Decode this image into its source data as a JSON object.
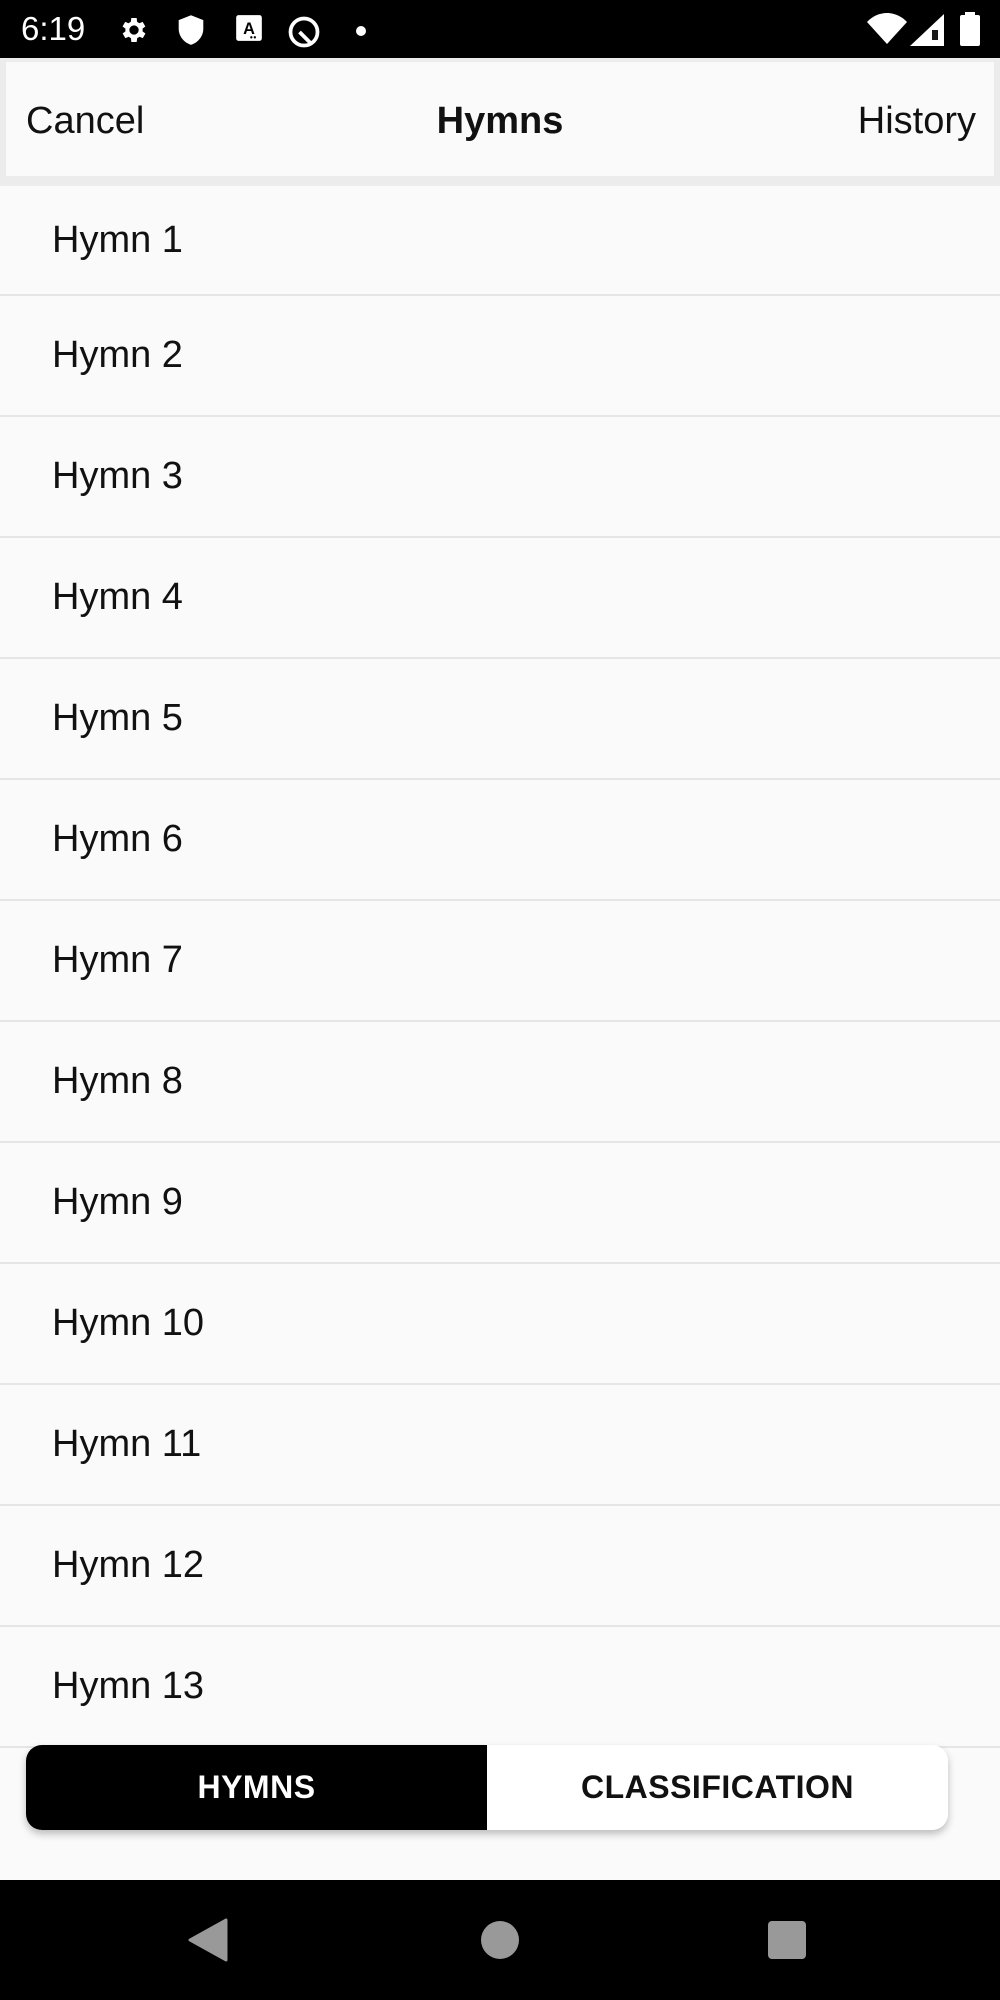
{
  "status_bar": {
    "time": "6:19",
    "left_icons": [
      "gear-icon",
      "shield-icon",
      "font-a-icon",
      "circle-q-icon",
      "dot-icon"
    ],
    "right_icons": [
      "wifi-icon",
      "signal-icon",
      "battery-icon"
    ]
  },
  "header": {
    "cancel_label": "Cancel",
    "title": "Hymns",
    "history_label": "History"
  },
  "list": {
    "items": [
      {
        "label": "Hymn 1"
      },
      {
        "label": "Hymn 2"
      },
      {
        "label": "Hymn 3"
      },
      {
        "label": "Hymn 4"
      },
      {
        "label": "Hymn 5"
      },
      {
        "label": "Hymn 6"
      },
      {
        "label": "Hymn 7"
      },
      {
        "label": "Hymn 8"
      },
      {
        "label": "Hymn 9"
      },
      {
        "label": "Hymn 10"
      },
      {
        "label": "Hymn 11"
      },
      {
        "label": "Hymn 12"
      },
      {
        "label": "Hymn 13"
      }
    ]
  },
  "segmented_control": {
    "tabs": [
      {
        "label": "HYMNS",
        "active": true
      },
      {
        "label": "CLASSIFICATION",
        "active": false
      }
    ]
  },
  "nav_bar": {
    "buttons": [
      "back-icon",
      "home-icon",
      "recents-icon"
    ]
  },
  "colors": {
    "active_tab_bg": "#000000",
    "inactive_tab_bg": "#ffffff",
    "background": "#fafafa",
    "divider": "#e5e5e5"
  }
}
